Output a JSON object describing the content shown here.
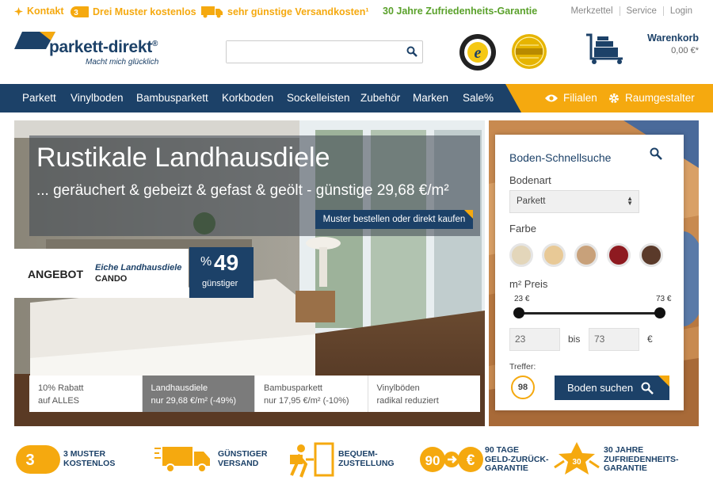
{
  "topbar": {
    "kontakt": "Kontakt",
    "muster_badge": "3",
    "muster": "Drei Muster kostenlos",
    "versand": "sehr günstige Versandkosten¹",
    "garantie": "30 Jahre Zufriedenheits-Garantie",
    "links": [
      "Merkzettel",
      "Service",
      "Login"
    ]
  },
  "header": {
    "logo_name": "parkett-direkt",
    "logo_reg": "®",
    "logo_tagline": "Macht mich glücklich",
    "search_placeholder": "",
    "cart_label": "Warenkorb",
    "cart_value": "0,00 €*"
  },
  "nav": {
    "items": [
      "Parkett",
      "Vinylboden",
      "Bambusparkett",
      "Korkboden",
      "Sockelleisten",
      "Zubehör",
      "Marken",
      "Sale%"
    ],
    "filialen": "Filialen",
    "raumgestalter": "Raumgestalter"
  },
  "hero": {
    "title": "Rustikale Landhausdiele",
    "subtitle": "... geräuchert & gebeizt & gefast & geölt - günstige 29,68 €/m²",
    "button": "Muster bestellen oder direkt kaufen",
    "offer_label": "ANGEBOT",
    "offer_product": "Eiche Landhausdiele",
    "offer_product_name": "CANDO",
    "discount_pct": "%",
    "discount_value": "49",
    "discount_label": "günstiger",
    "tabs": [
      {
        "line1": "10% Rabatt",
        "line2": "auf ALLES"
      },
      {
        "line1": "Landhausdiele",
        "line2": "nur 29,68 €/m² (-49%)"
      },
      {
        "line1": "Bambusparkett",
        "line2": "nur 17,95 €/m² (-10%)"
      },
      {
        "line1": "Vinylböden",
        "line2": "radikal reduziert"
      }
    ]
  },
  "quicksearch": {
    "title": "Boden-Schnellsuche",
    "bodenart_label": "Bodenart",
    "bodenart_value": "Parkett",
    "farbe_label": "Farbe",
    "colors": [
      "#e3d6ba",
      "#e8c996",
      "#c8a17a",
      "#8e1a20",
      "#5a3a2a"
    ],
    "preis_label": "m² Preis",
    "min_label": "23 €",
    "max_label": "73 €",
    "min_value": "23",
    "bis": "bis",
    "max_value": "73",
    "currency": "€",
    "treffer_label": "Treffer:",
    "treffer_count": "98",
    "submit": "Boden suchen"
  },
  "features": [
    {
      "badge": "3",
      "line1": "3 MUSTER",
      "line2": "KOSTENLOS"
    },
    {
      "line1": "GÜNSTIGER",
      "line2": "VERSAND"
    },
    {
      "line1": "BEQUEM-",
      "line2": "ZUSTELLUNG"
    },
    {
      "badge1": "90",
      "badge2": "€",
      "line1": "90 TAGE",
      "line2": "GELD-ZURÜCK-",
      "line3": "GARANTIE"
    },
    {
      "badge": "30",
      "line1": "30 JAHRE",
      "line2": "ZUFRIEDENHEITS-",
      "line3": "GARANTIE"
    }
  ],
  "colors": {
    "brand_blue": "#1c4168",
    "accent_yellow": "#f5a90f",
    "green": "#5aa12b"
  }
}
